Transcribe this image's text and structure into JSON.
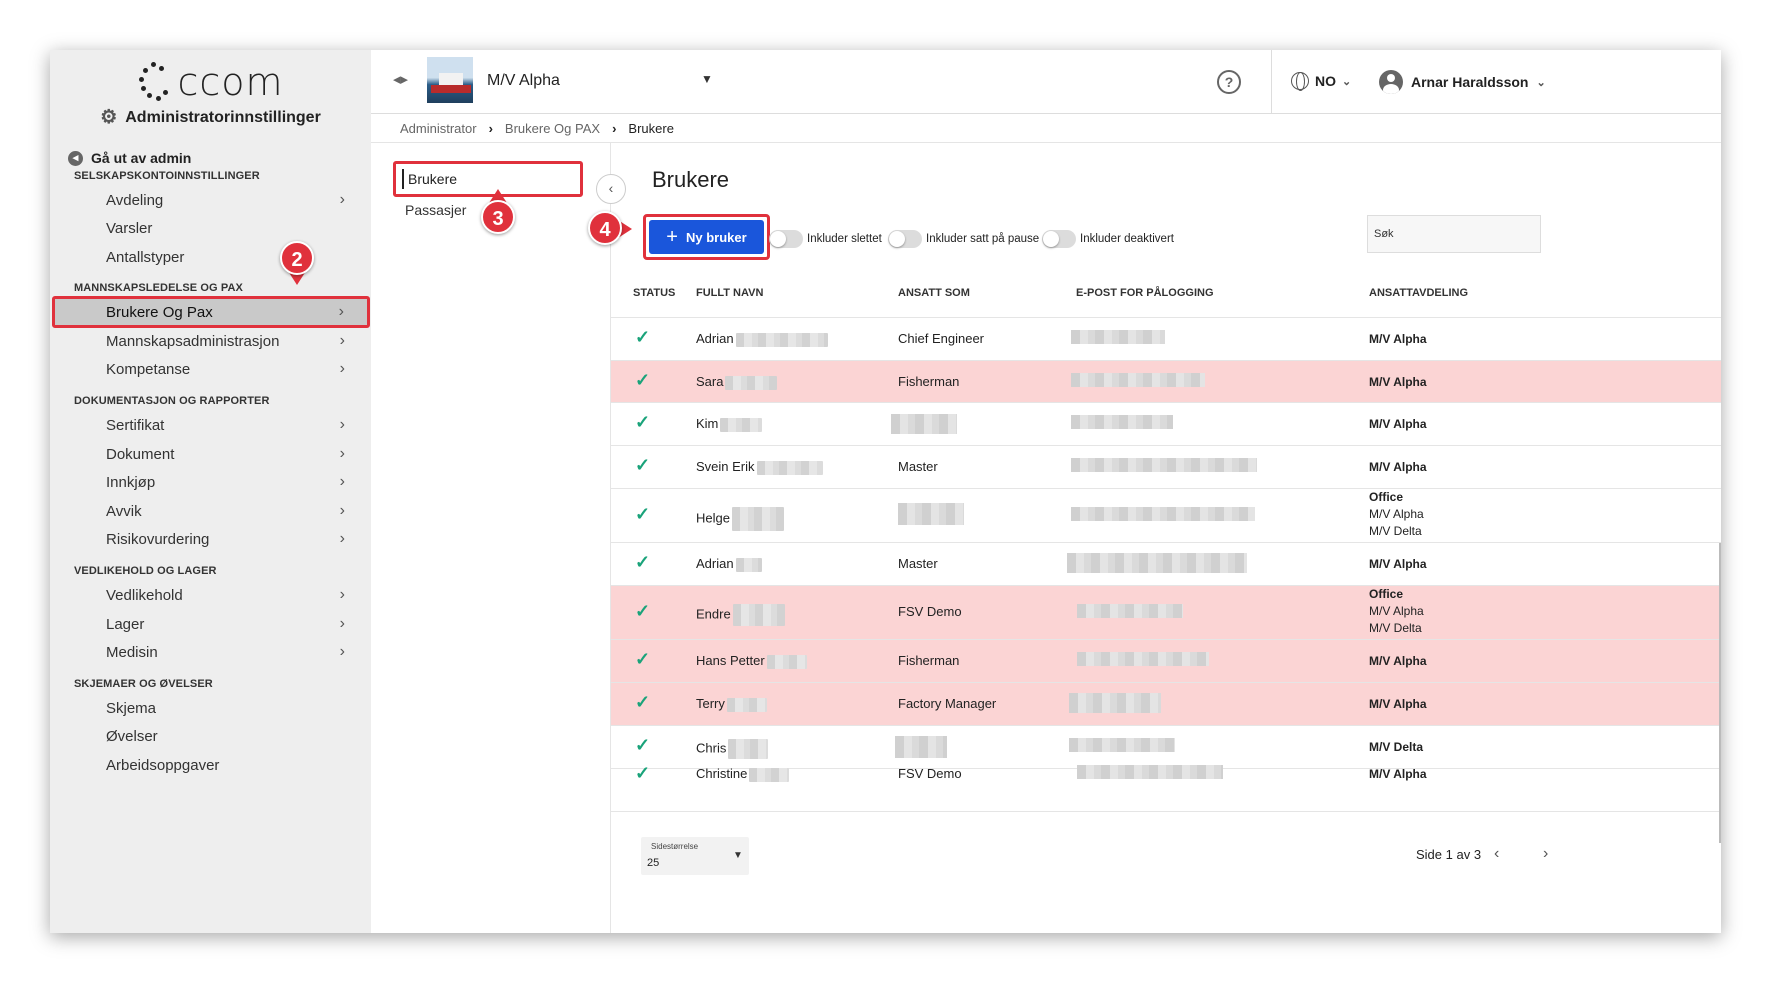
{
  "brand": {
    "logo_text": "ccom",
    "admin_title": "Administratorinnstillinger"
  },
  "sidebar": {
    "exit_label": "Gå ut av admin",
    "sections": [
      {
        "title": "SELSKAPSKONTOINNSTILLINGER"
      },
      {
        "title": "MANNSKAPSLEDELSE OG PAX"
      },
      {
        "title": "DOKUMENTASJON OG RAPPORTER"
      },
      {
        "title": "VEDLIKEHOLD OG LAGER"
      },
      {
        "title": "SKJEMAER OG ØVELSER"
      }
    ],
    "items": [
      {
        "label": "Avdeling"
      },
      {
        "label": "Varsler"
      },
      {
        "label": "Antallstyper"
      },
      {
        "label": "Brukere Og Pax"
      },
      {
        "label": "Mannskapsadministrasjon"
      },
      {
        "label": "Kompetanse"
      },
      {
        "label": "Sertifikat"
      },
      {
        "label": "Dokument"
      },
      {
        "label": "Innkjøp"
      },
      {
        "label": "Avvik"
      },
      {
        "label": "Risikovurdering"
      },
      {
        "label": "Vedlikehold"
      },
      {
        "label": "Lager"
      },
      {
        "label": "Medisin"
      },
      {
        "label": "Skjema"
      },
      {
        "label": "Øvelser"
      },
      {
        "label": "Arbeidsoppgaver"
      }
    ]
  },
  "topbar": {
    "vessel": "M/V Alpha",
    "language": "NO",
    "user": "Arnar Haraldsson",
    "help_icon": "question-circle-icon"
  },
  "breadcrumb": [
    "Administrator",
    "Brukere Og PAX",
    "Brukere"
  ],
  "subnav": {
    "items": [
      {
        "label": "Brukere"
      },
      {
        "label": "Passasjer"
      }
    ]
  },
  "badges": [
    "2",
    "3",
    "4"
  ],
  "main": {
    "title": "Brukere",
    "new_button": "Ny bruker",
    "toggles": [
      "Inkluder slettet",
      "Inkluder satt på pause",
      "Inkluder deaktivert"
    ],
    "search_placeholder": "Søk",
    "columns": [
      "STATUS",
      "FULLT NAVN",
      "ANSATT SOM",
      "E-POST FOR PÅLOGGING",
      "ANSATTAVDELING"
    ],
    "rows": [
      {
        "status": "✓",
        "name": "Adrian",
        "role": "Chief Engineer",
        "depts": [
          "M/V Alpha"
        ],
        "highlight": false
      },
      {
        "status": "✓",
        "name": "Sara",
        "role": "Fisherman",
        "depts": [
          "M/V Alpha"
        ],
        "highlight": true
      },
      {
        "status": "✓",
        "name": "Kim",
        "role": "",
        "depts": [
          "M/V Alpha"
        ],
        "highlight": false
      },
      {
        "status": "✓",
        "name": "Svein Erik",
        "role": "Master",
        "depts": [
          "M/V Alpha"
        ],
        "highlight": false
      },
      {
        "status": "✓",
        "name": "Helge",
        "role": "",
        "depts": [
          "Office",
          "M/V Alpha",
          "M/V Delta"
        ],
        "highlight": false
      },
      {
        "status": "✓",
        "name": "Adrian",
        "role": "Master",
        "depts": [
          "M/V Alpha"
        ],
        "highlight": false
      },
      {
        "status": "✓",
        "name": "Endre",
        "role": "FSV Demo",
        "depts": [
          "Office",
          "M/V Alpha",
          "M/V Delta"
        ],
        "highlight": true
      },
      {
        "status": "✓",
        "name": "Hans Petter",
        "role": "Fisherman",
        "depts": [
          "M/V Alpha"
        ],
        "highlight": true
      },
      {
        "status": "✓",
        "name": "Terry",
        "role": "Factory Manager",
        "depts": [
          "M/V Alpha"
        ],
        "highlight": true
      },
      {
        "status": "✓",
        "name": "Chris",
        "role": "",
        "depts": [
          "M/V Delta"
        ],
        "highlight": false
      },
      {
        "status": "✓",
        "name": "Christine",
        "role": "FSV Demo",
        "depts": [
          "M/V Alpha"
        ],
        "highlight": false
      }
    ],
    "pager": {
      "page_size_label": "Sidestørrelse",
      "page_size": "25",
      "page_info": "Side 1 av 3"
    }
  },
  "colors": {
    "accent": "#1a56db",
    "highlight_row": "#fbd4d4",
    "annotation": "#e0313c",
    "check": "#1aa37a"
  }
}
